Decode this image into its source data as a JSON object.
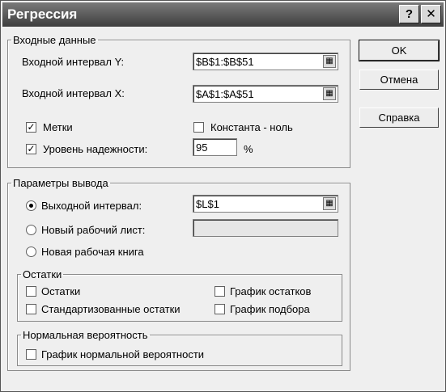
{
  "window": {
    "title": "Регрессия",
    "help_glyph": "?",
    "close_glyph": "✕"
  },
  "input_group": {
    "legend": "Входные данные",
    "y_label": "Входной интервал Y:",
    "y_value": "$B$1:$B$51",
    "x_label": "Входной интервал X:",
    "x_value": "$A$1:$A$51",
    "labels": {
      "label": "Метки",
      "checked": true
    },
    "constant_zero": {
      "label": "Константа - ноль",
      "checked": false
    },
    "confidence": {
      "label": "Уровень надежности:",
      "checked": true,
      "value": "95",
      "unit": "%"
    }
  },
  "output_group": {
    "legend": "Параметры вывода",
    "output_range": {
      "label": "Выходной интервал:",
      "value": "$L$1",
      "selected": true
    },
    "new_sheet": {
      "label": "Новый рабочий лист:",
      "value": "",
      "selected": false
    },
    "new_workbook": {
      "label": "Новая рабочая книга",
      "selected": false
    }
  },
  "residuals_group": {
    "legend": "Остатки",
    "residuals": {
      "label": "Остатки",
      "checked": false
    },
    "std_residuals": {
      "label": "Стандартизованные остатки",
      "checked": false
    },
    "residual_plot": {
      "label": "График остатков",
      "checked": false
    },
    "fit_plot": {
      "label": "График подбора",
      "checked": false
    }
  },
  "normal_group": {
    "legend": "Нормальная вероятность",
    "normal_plot": {
      "label": "График нормальной вероятности",
      "checked": false
    }
  },
  "buttons": {
    "ok": "OK",
    "cancel": "Отмена",
    "help": "Справка"
  },
  "icons": {
    "ref_button": "range-select-icon",
    "check_mark": "✓"
  }
}
